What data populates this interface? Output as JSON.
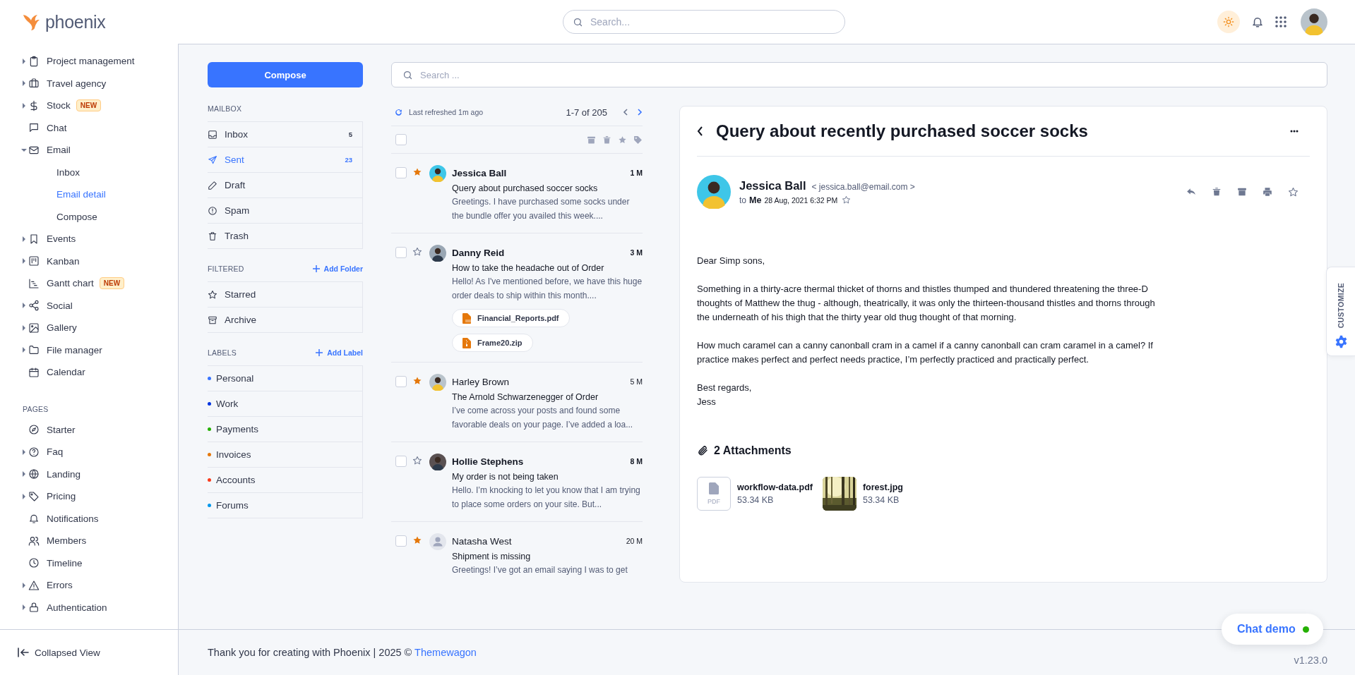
{
  "brand": {
    "name": "phoenix"
  },
  "topbar": {
    "search_placeholder": "Search..."
  },
  "sidebar": {
    "menu": [
      {
        "label": "Project management",
        "expanded": false,
        "selected": false
      },
      {
        "label": "Travel agency",
        "expanded": false,
        "selected": false
      },
      {
        "label": "Stock",
        "expanded": false,
        "badge": "NEW",
        "selected": false
      },
      {
        "label": "Chat",
        "selected": false
      },
      {
        "label": "Email",
        "expanded": true,
        "selected": false,
        "children": [
          {
            "label": "Inbox",
            "selected": false
          },
          {
            "label": "Email detail",
            "selected": true
          },
          {
            "label": "Compose",
            "selected": false
          }
        ]
      },
      {
        "label": "Events",
        "expanded": false,
        "selected": false
      },
      {
        "label": "Kanban",
        "expanded": false,
        "selected": false
      },
      {
        "label": "Gantt chart",
        "badge": "NEW",
        "selected": false
      },
      {
        "label": "Social",
        "expanded": false,
        "selected": false
      },
      {
        "label": "Gallery",
        "expanded": false,
        "selected": false
      },
      {
        "label": "File manager",
        "expanded": false,
        "selected": false
      },
      {
        "label": "Calendar",
        "selected": false
      }
    ],
    "pages_heading": "PAGES",
    "pages": [
      {
        "label": "Starter",
        "selected": false
      },
      {
        "label": "Faq",
        "expanded": false,
        "selected": false
      },
      {
        "label": "Landing",
        "expanded": false,
        "selected": false
      },
      {
        "label": "Pricing",
        "expanded": false,
        "selected": false
      },
      {
        "label": "Notifications",
        "selected": false
      },
      {
        "label": "Members",
        "selected": false
      },
      {
        "label": "Timeline",
        "selected": false
      },
      {
        "label": "Errors",
        "expanded": false,
        "selected": false
      },
      {
        "label": "Authentication",
        "expanded": false,
        "selected": false
      }
    ],
    "collapse_label": "Collapsed View"
  },
  "mailbox": {
    "compose": "Compose",
    "heading": "MAILBOX",
    "folders": [
      {
        "label": "Inbox",
        "count": "5",
        "selected": false
      },
      {
        "label": "Sent",
        "count": "23",
        "selected": true
      },
      {
        "label": "Draft",
        "selected": false
      },
      {
        "label": "Spam",
        "selected": false
      },
      {
        "label": "Trash",
        "selected": false
      }
    ],
    "filtered": {
      "heading": "FILTERED",
      "action": "Add Folder",
      "items": [
        {
          "label": "Starred",
          "selected": false
        },
        {
          "label": "Archive",
          "selected": false
        }
      ]
    },
    "labels": {
      "heading": "LABELS",
      "action": "Add Label",
      "items": [
        {
          "label": "Personal",
          "color": "#3874ff",
          "selected": false
        },
        {
          "label": "Work",
          "color": "#0033e0",
          "selected": false
        },
        {
          "label": "Payments",
          "color": "#25b003",
          "selected": false
        },
        {
          "label": "Invoices",
          "color": "#e5780b",
          "selected": false
        },
        {
          "label": "Accounts",
          "color": "#fa3b1d",
          "selected": false
        },
        {
          "label": "Forums",
          "color": "#0097eb",
          "selected": false
        }
      ]
    }
  },
  "search": {
    "placeholder": "Search ..."
  },
  "list": {
    "refreshed": "Last refreshed 1m ago",
    "pagination": "1-7 of 205",
    "select_all": {
      "checked": false
    },
    "emails": [
      {
        "sender": "Jessica Ball",
        "time": "1 M",
        "starred": true,
        "unread": true,
        "checked": false,
        "photo": true,
        "subject": "Query about purchased soccer socks",
        "preview": "Greetings. I have purchased some socks under the bundle offer you availed this week...."
      },
      {
        "sender": "Danny Reid",
        "time": "3 M",
        "starred": false,
        "unread": true,
        "checked": false,
        "photo": true,
        "subject": "How to take the headache out of Order",
        "preview": "Hello! As I've mentioned before, we have this huge order deals to ship within this month....",
        "attachments": [
          {
            "name": "Financial_Reports.pdf",
            "kind": "pdf"
          },
          {
            "name": "Frame20.zip",
            "kind": "zip"
          }
        ]
      },
      {
        "sender": "Harley Brown",
        "time": "5 M",
        "starred": true,
        "unread": false,
        "checked": false,
        "photo": true,
        "subject": "The Arnold Schwarzenegger of Order",
        "preview": "I’ve come across your posts and found some favorable deals on your page. I’ve added a loa..."
      },
      {
        "sender": "Hollie Stephens",
        "time": "8 M",
        "starred": false,
        "unread": true,
        "checked": false,
        "photo": true,
        "subject": "My order is not being taken",
        "preview": "Hello. I’m knocking to let you know that I am trying to place some orders on your site. But..."
      },
      {
        "sender": "Natasha West",
        "time": "20 M",
        "starred": true,
        "unread": false,
        "checked": false,
        "photo": false,
        "subject": "Shipment is missing",
        "preview": "Greetings! I’ve got an email saying I was to get"
      }
    ]
  },
  "detail": {
    "title": "Query about recently purchased soccer socks",
    "sender": "Jessica Ball",
    "address": "< jessica.ball@email.com >",
    "to_label": "to",
    "recipient": "Me",
    "date": "28 Aug, 2021 6:32 PM",
    "starred": false,
    "paragraphs": [
      "Dear Simp sons,",
      "Something in a thirty-acre thermal thicket of thorns and thistles thumped and thundered threatening the three-D thoughts of Matthew the thug - although, theatrically, it was only the thirteen-thousand thistles and thorns through the underneath of his thigh that the thirty year old thug thought of that morning.",
      "How much caramel can a canny canonball cram in a camel if a canny canonball can cram caramel in a camel? If practice makes perfect and perfect needs practice, I’m perfectly practiced and practically perfect.",
      "Best regards,\nJess"
    ],
    "attachments_heading": "2 Attachments",
    "files": [
      {
        "name": "workflow-data.pdf",
        "size": "53.34 KB",
        "kind": "pdf",
        "type_label": "PDF"
      },
      {
        "name": "forest.jpg",
        "size": "53.34 KB",
        "kind": "picture"
      }
    ]
  },
  "customize": {
    "label": "CUSTOMIZE"
  },
  "chat": {
    "label": "Chat demo",
    "online": true
  },
  "footer": {
    "text": "Thank you for creating with Phoenix | 2025 © ",
    "link": "Themewagon",
    "version": "v1.23.0"
  }
}
